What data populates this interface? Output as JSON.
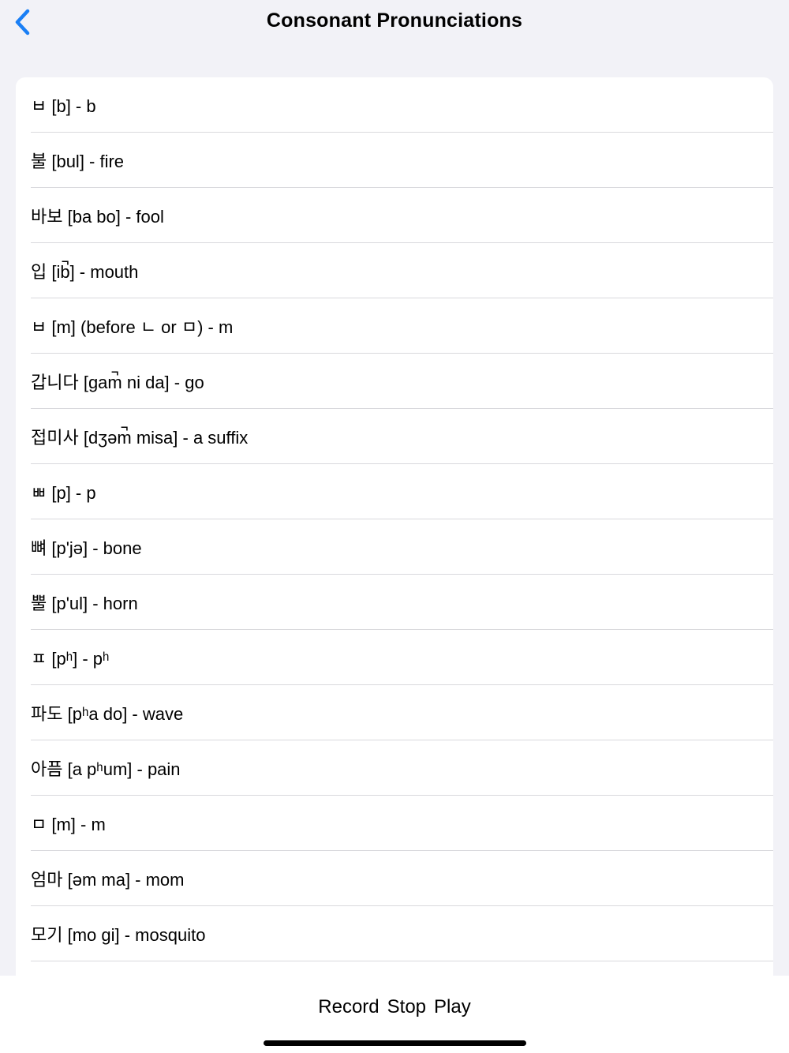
{
  "nav": {
    "title": "Consonant Pronunciations",
    "back_icon": "chevron-left-icon",
    "accent_color": "#1a7ff5"
  },
  "items": [
    {
      "label": "ㅂ [b] - b"
    },
    {
      "label": "불 [bul] - fire"
    },
    {
      "label": "바보 [ba bo] - fool"
    },
    {
      "label": "입 [ib̚] - mouth"
    },
    {
      "label": "ㅂ [m] (before ㄴ or ㅁ) - m"
    },
    {
      "label": "갑니다 [gam̚ ni da] - go"
    },
    {
      "label": "접미사 [dʒəm̚ misa] - a suffix"
    },
    {
      "label": "ㅃ [p] - p"
    },
    {
      "label": "뼈 [p'jə] - bone"
    },
    {
      "label": "뿔 [p'ul] - horn"
    },
    {
      "label": "ㅍ [pʰ] - pʰ"
    },
    {
      "label": "파도 [pʰa do] - wave"
    },
    {
      "label": "아픔 [a pʰum] - pain"
    },
    {
      "label": "ㅁ [m] - m"
    },
    {
      "label": "엄마 [əm ma] - mom"
    },
    {
      "label": "모기 [mo gi] - mosquito"
    },
    {
      "label": ""
    }
  ],
  "controls": {
    "record_label": "Record",
    "stop_label": "Stop",
    "play_label": "Play"
  }
}
